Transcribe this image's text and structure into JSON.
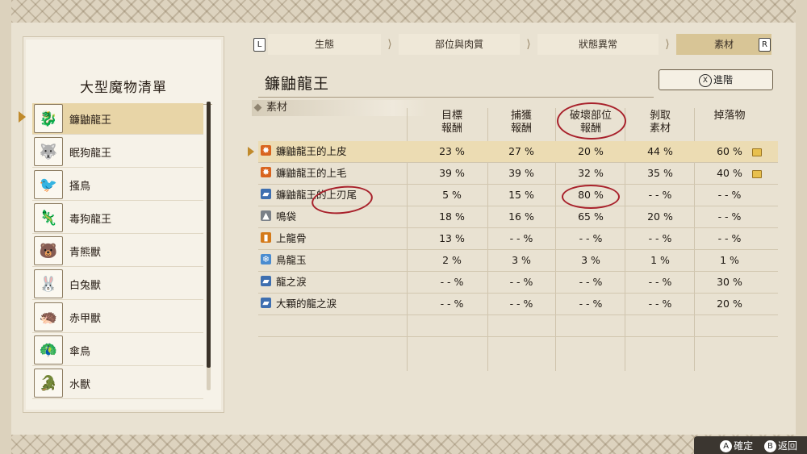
{
  "left_panel": {
    "title": "大型魔物清單",
    "monsters": [
      {
        "name": "鐮鼬龍王",
        "icon": "🐉"
      },
      {
        "name": "眠狗龍王",
        "icon": "🐺"
      },
      {
        "name": "搔鳥",
        "icon": "🐦"
      },
      {
        "name": "毒狗龍王",
        "icon": "🦎"
      },
      {
        "name": "青熊獸",
        "icon": "🐻"
      },
      {
        "name": "白兔獸",
        "icon": "🐰"
      },
      {
        "name": "赤甲獸",
        "icon": "🦔"
      },
      {
        "name": "傘鳥",
        "icon": "🦚"
      },
      {
        "name": "水獸",
        "icon": "🐊"
      }
    ]
  },
  "tabs": {
    "left_key": "L",
    "right_key": "R",
    "items": [
      {
        "label": "生態"
      },
      {
        "label": "部位與肉質"
      },
      {
        "label": "狀態異常"
      },
      {
        "label": "素材"
      }
    ]
  },
  "main": {
    "monster_title": "鐮鼬龍王",
    "advance_key": "X",
    "advance_label": "進階",
    "section_label": "素材",
    "columns": [
      {
        "line1": "目標",
        "line2": "報酬"
      },
      {
        "line1": "捕獲",
        "line2": "報酬"
      },
      {
        "line1": "破壞部位",
        "line2": "報酬"
      },
      {
        "line1": "剝取",
        "line2": "素材"
      },
      {
        "line1": "掉落物",
        "line2": ""
      }
    ],
    "rows": [
      {
        "name": "鐮鼬龍王的上皮",
        "icon": "✸",
        "icon_color": "#d9641e",
        "values": [
          "23 %",
          "27 %",
          "20 %",
          "44 %",
          "60 %"
        ],
        "drop_icon": true
      },
      {
        "name": "鐮鼬龍王的上毛",
        "icon": "✸",
        "icon_color": "#d9641e",
        "values": [
          "39 %",
          "39 %",
          "32 %",
          "35 %",
          "40 %"
        ],
        "drop_icon": true
      },
      {
        "name": "鐮鼬龍王的上刃尾",
        "icon": "▰",
        "icon_color": "#3e6fb0",
        "values": [
          "5 %",
          "15 %",
          "80 %",
          "- - %",
          "- - %"
        ],
        "drop_icon": false
      },
      {
        "name": "鳴袋",
        "icon": "▲",
        "icon_color": "#7a8088",
        "values": [
          "18 %",
          "16 %",
          "65 %",
          "20 %",
          "- - %"
        ],
        "drop_icon": false
      },
      {
        "name": "上龍骨",
        "icon": "▮",
        "icon_color": "#d47a1a",
        "values": [
          "13 %",
          "- - %",
          "- - %",
          "- - %",
          "- - %"
        ],
        "drop_icon": false
      },
      {
        "name": "鳥龍玉",
        "icon": "❄",
        "icon_color": "#4a8cd0",
        "values": [
          "2 %",
          "3 %",
          "3 %",
          "1 %",
          "1 %"
        ],
        "drop_icon": false
      },
      {
        "name": "龍之淚",
        "icon": "▰",
        "icon_color": "#3e6fb0",
        "values": [
          "- - %",
          "- - %",
          "- - %",
          "- - %",
          "30 %"
        ],
        "drop_icon": false
      },
      {
        "name": "大顆的龍之淚",
        "icon": "▰",
        "icon_color": "#3e6fb0",
        "values": [
          "- - %",
          "- - %",
          "- - %",
          "- - %",
          "20 %"
        ],
        "drop_icon": false
      }
    ]
  },
  "footer": {
    "confirm_key": "A",
    "confirm_label": "確定",
    "back_key": "B",
    "back_label": "返回"
  },
  "colors": {
    "highlight_row": "#ecdcb3",
    "annotation_red": "#a8212b",
    "selection_arrow": "#c08a2c"
  }
}
